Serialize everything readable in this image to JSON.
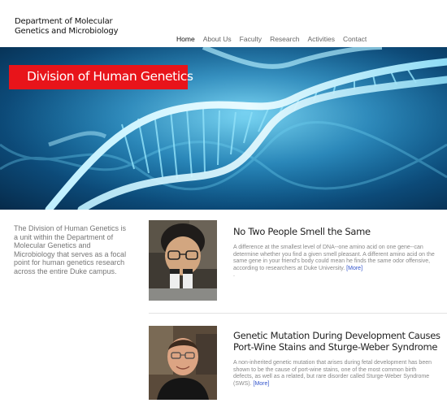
{
  "header": {
    "site_title": "Department of Molecular Genetics and Microbiology",
    "nav": [
      "Home",
      "About Us",
      "Faculty",
      "Research",
      "Activities",
      "Contact"
    ]
  },
  "hero": {
    "title": "Division of Human Genetics",
    "banner_color": "#e8141a"
  },
  "intro": {
    "text": "The Division of Human Genetics is a unit within the Department of Molecular Genetics and Microbiology that serves as a focal point for human genetics research across the entire Duke campus."
  },
  "news": [
    {
      "headline": "No Two People Smell the Same",
      "summary": "A difference at the smallest level of DNA--one amino acid on one gene--can determine whether you find a given smell pleasant. A different amino acid on the same gene in your friend's body could mean he finds the same odor offensive, according to researchers at Duke University.",
      "more_label": "[More]",
      "trailing": "."
    },
    {
      "headline": "Genetic Mutation During Development Causes Port-Wine Stains and Sturge-Weber Syndrome",
      "summary": "A non-inherited genetic mutation that arises during fetal development has been shown to be the cause of port-wine stains, one of the most common birth defects, as well as a related, but rare disorder called Sturge-Weber Syndrome (SWS).",
      "more_label": "[More]"
    }
  ],
  "colors": {
    "link": "#3355cc",
    "hero_accent": "#4fc3e8"
  }
}
